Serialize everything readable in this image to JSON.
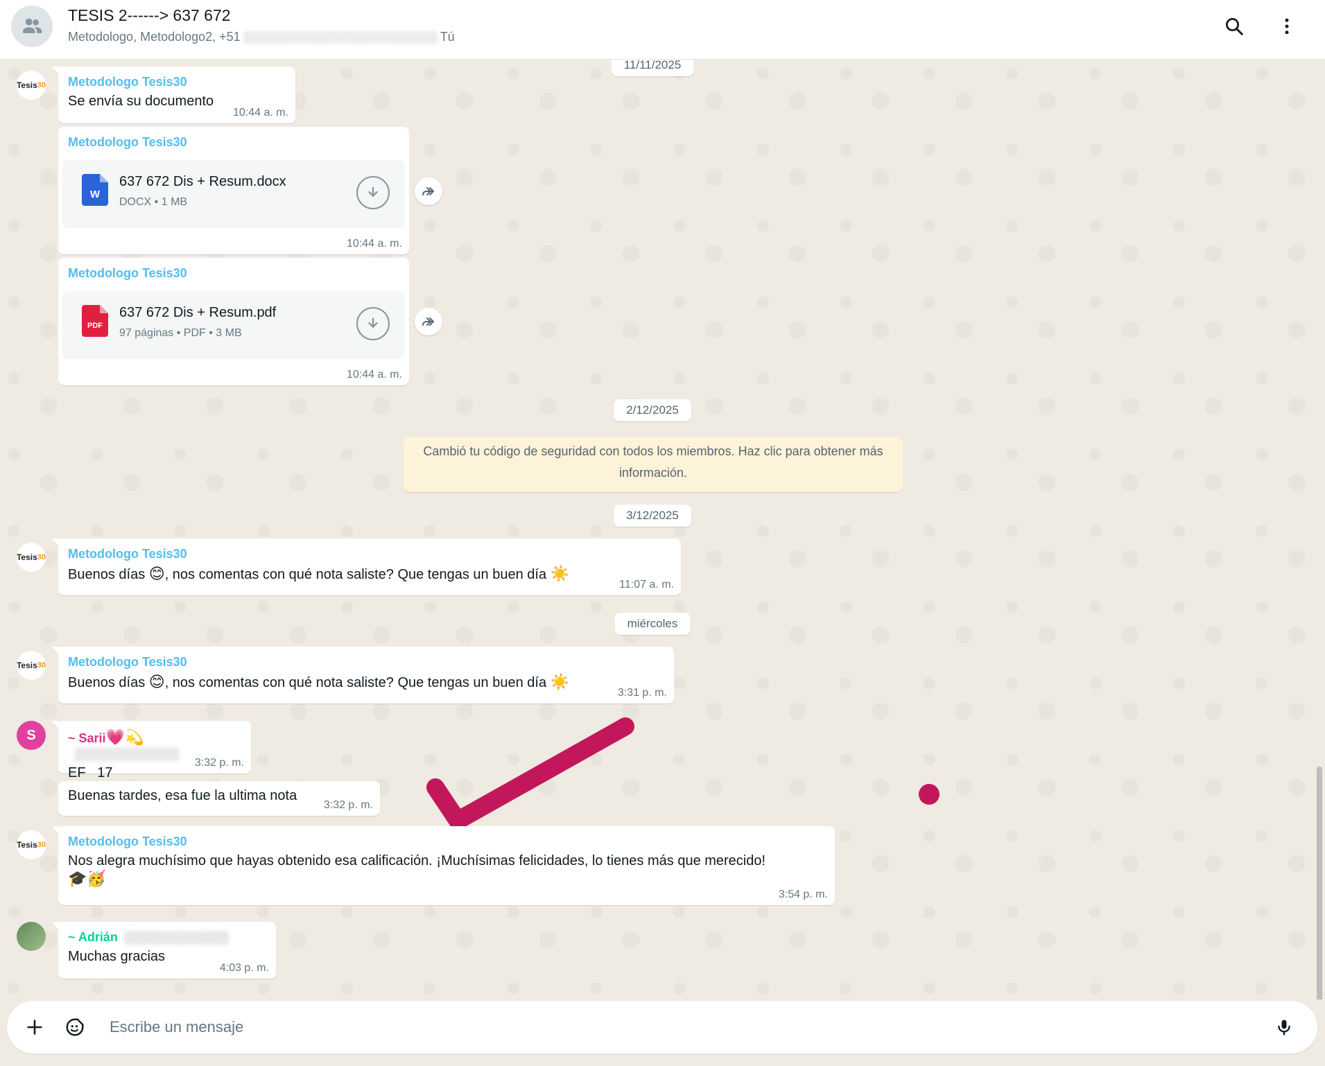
{
  "header": {
    "title": "TESIS 2------> 637 672",
    "subtitle_start": "Metodologo, Metodologo2, +51",
    "subtitle_end": "Tú"
  },
  "dates": {
    "d1": "11/11/2025",
    "d2": "2/12/2025",
    "d3": "3/12/2025",
    "d4": "miércoles"
  },
  "avatar_logo": {
    "t": "Tesis",
    "n": "30"
  },
  "messages": {
    "m1": {
      "sender": "Metodologo Tesis30",
      "text": "Se envía su documento",
      "time": "10:44 a. m."
    },
    "m2": {
      "sender": "Metodologo Tesis30",
      "file": "637 672 Dis + Resum.docx",
      "meta": "DOCX • 1 MB",
      "time": "10:44 a. m.",
      "icon_letter": "W"
    },
    "m3": {
      "sender": "Metodologo Tesis30",
      "file": "637 672 Dis + Resum.pdf",
      "meta": "97 páginas • PDF • 3 MB",
      "time": "10:44 a. m.",
      "icon_letter": "PDF"
    },
    "system": "Cambió tu código de seguridad con todos los miembros. Haz clic para obtener más información.",
    "m4": {
      "sender": "Metodologo Tesis30",
      "text_a": "Buenos días ",
      "emoji_a": "😊",
      "text_b": ", nos comentas con qué nota saliste? Que tengas un buen día ",
      "emoji_b": "☀️",
      "time": "11:07 a. m."
    },
    "m5": {
      "sender": "Metodologo Tesis30",
      "text_a": "Buenos días ",
      "emoji_a": "😊",
      "text_b": ", nos comentas con qué nota saliste? Que tengas un buen día ",
      "emoji_b": "☀️",
      "time": "3:31 p. m."
    },
    "m6": {
      "avatar_letter": "S",
      "sender": "~ Sarii",
      "sender_emoji": "💗💫",
      "text": "EF   17",
      "time": "3:32 p. m."
    },
    "m7": {
      "text": "Buenas tardes, esa fue la ultima nota",
      "time": "3:32 p. m."
    },
    "m8": {
      "sender": "Metodologo Tesis30",
      "text": "Nos alegra muchísimo que hayas obtenido esa calificación. ¡Muchísimas felicidades, lo tienes más que merecido!",
      "emoji": "🎓🥳",
      "time": "3:54 p. m."
    },
    "m9": {
      "sender": "~ Adrián",
      "text": "Muchas gracias",
      "time": "4:03 p. m."
    }
  },
  "compose": {
    "placeholder": "Escribe un mensaje"
  },
  "icons": {
    "group": "group-avatar-icon",
    "search": "search-icon",
    "menu": "kebab-menu-icon",
    "download": "download-icon",
    "forward": "forward-icon",
    "plus": "plus-icon",
    "sticker": "sticker-icon",
    "mic": "microphone-icon"
  },
  "colors": {
    "sender": "#53bdeb",
    "checkmark_annotation": "#c2185b",
    "system_bg": "#fdf3d8"
  }
}
